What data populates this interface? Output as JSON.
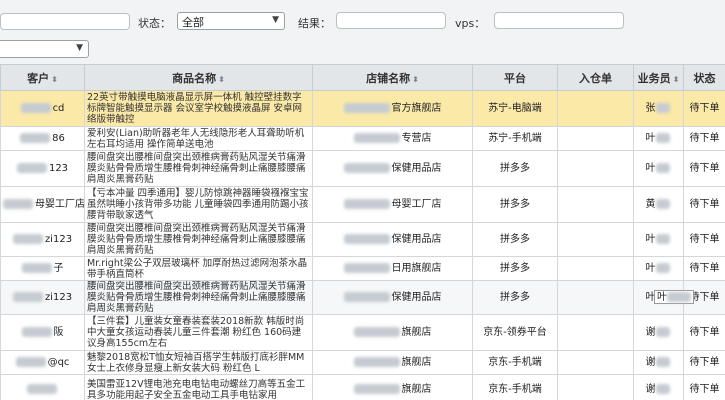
{
  "filters": {
    "status_label": "状态：",
    "status_value": "全部",
    "result_label": "结果：",
    "vps_label": "vps："
  },
  "table": {
    "headers": {
      "customer": "客户",
      "product": "商品名称",
      "store": "店铺名称",
      "platform": "平台",
      "warehouse": "入仓单",
      "salesperson": "业务员",
      "status": "状态"
    },
    "rows": [
      {
        "customer": "cd",
        "product": "22英寸带触摸电脑液晶显示屏一体机 触控壁挂数字标牌智能触摸显示器 会议室学校触摸液晶屏 安卓网络版带触控",
        "store": "官方旗舰店",
        "platform": "苏宁-电脑端",
        "salesperson": "张",
        "status": "待下单"
      },
      {
        "customer": "86",
        "product": "爱利安(Lian)助听器老年人无线隐形老人耳聋助听机 左右耳均适用 操作简单送电池",
        "store": "专营店",
        "platform": "苏宁-手机端",
        "salesperson": "叶",
        "status": "待下单"
      },
      {
        "customer": "123",
        "product": "腰间盘突出腰椎间盘突出颈椎病膏药贴风湿关节痛滑膜炎贴骨骨质增生腰椎骨刺神经痛骨刺止痛腰膝腰痛肩周炎黑膏药贴",
        "store": "保健用品店",
        "platform": "拼多多",
        "salesperson": "叶",
        "status": "待下单"
      },
      {
        "customer": "母婴工厂店",
        "product": "【亏本冲量 四季通用】婴儿防惊跳神器睡袋襁褓宝宝虽然哄睡小孩背带多功能 儿童睡袋四季通用防踢小孩腰背带耿家透气",
        "store": "母婴工厂店",
        "platform": "拼多多",
        "salesperson": "黄",
        "status": "待下单"
      },
      {
        "customer": "zi123",
        "product": "腰间盘突出腰椎间盘突出颈椎病膏药贴风湿关节痛滑膜炎贴骨骨质增生腰椎骨刺神经痛骨刺止痛腰膝腰痛肩周炎黑膏药贴",
        "store": "保健用品店",
        "platform": "拼多多",
        "salesperson": "叶",
        "status": "待下单"
      },
      {
        "customer": "子",
        "product": "Mr.right梁公子双层玻璃杯 加厚耐热过滤网泡茶水晶带手柄直筒杯",
        "store": "日用旗舰店",
        "platform": "拼多多",
        "salesperson": "叶",
        "status": "待下单"
      },
      {
        "customer": "zi123",
        "product": "腰间盘突出腰椎间盘突出颈椎病膏药贴风湿关节痛滑膜炎贴骨骨质增生腰椎骨刺神经痛骨刺止痛腰膝腰痛肩周炎黑膏药贴",
        "store": "保健用品店",
        "platform": "拼多多",
        "salesperson": "叶",
        "status": "待下单"
      },
      {
        "customer": "阪",
        "product": "【三件套】儿童装女童春装套装2018新款 韩版时尚中大童女孩运动春装儿童三件套潮 粉红色 160码建议身高155cm左右",
        "store": "旗舰店",
        "platform": "京东-领券平台",
        "salesperson": "谢",
        "status": "待下单"
      },
      {
        "customer": "@qc",
        "product": "魅黎2018宽松T恤女短袖百搭学生韩版打底衫胖MM女士上衣修身显瘦上新女装大码 粉红色 L",
        "store": "旗舰店",
        "platform": "京东-手机端",
        "salesperson": "谢",
        "status": "待下单"
      },
      {
        "customer": "",
        "product": "美国雷亚12V锂电池充电电钻电动螺丝刀高等五金工具多功能用起子安全五金电动工具手电钻家用",
        "store": "旗舰店",
        "platform": "京东-手机端",
        "salesperson": "谢",
        "status": "待下单"
      }
    ]
  },
  "tooltip": {
    "text": "叶"
  }
}
